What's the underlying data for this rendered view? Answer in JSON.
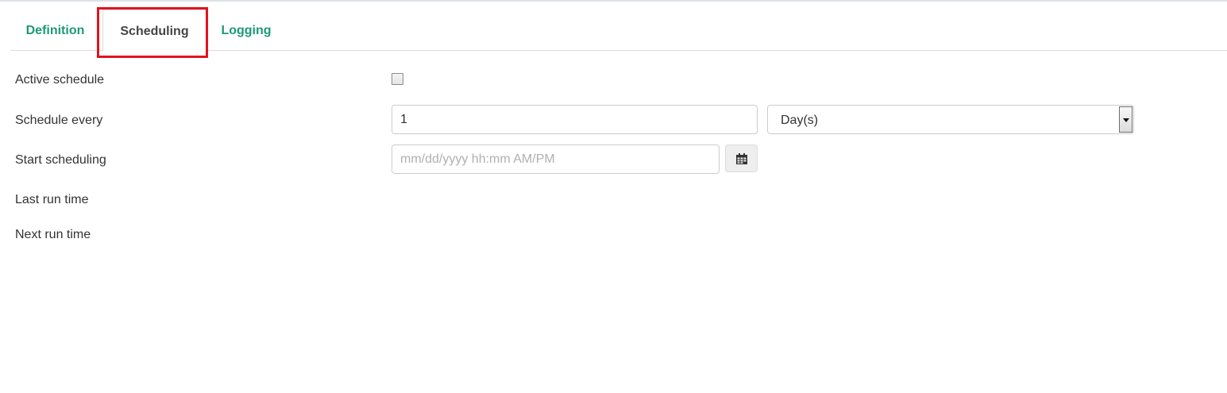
{
  "tabs": [
    {
      "label": "Definition",
      "active": false
    },
    {
      "label": "Scheduling",
      "active": true
    },
    {
      "label": "Logging",
      "active": false
    }
  ],
  "form": {
    "active_schedule": {
      "label": "Active schedule",
      "checked": false
    },
    "schedule_every": {
      "label": "Schedule every",
      "value": "1",
      "unit": "Day(s)"
    },
    "start_scheduling": {
      "label": "Start scheduling",
      "value": "",
      "placeholder": "mm/dd/yyyy hh:mm AM/PM"
    },
    "last_run_time": {
      "label": "Last run time"
    },
    "next_run_time": {
      "label": "Next run time"
    }
  },
  "icons": {
    "calendar": "calendar-icon",
    "dropdown": "chevron-down-icon"
  },
  "colors": {
    "tab_inactive": "#1b9a78",
    "tab_active": "#444444",
    "highlight_border": "#e0141e"
  }
}
